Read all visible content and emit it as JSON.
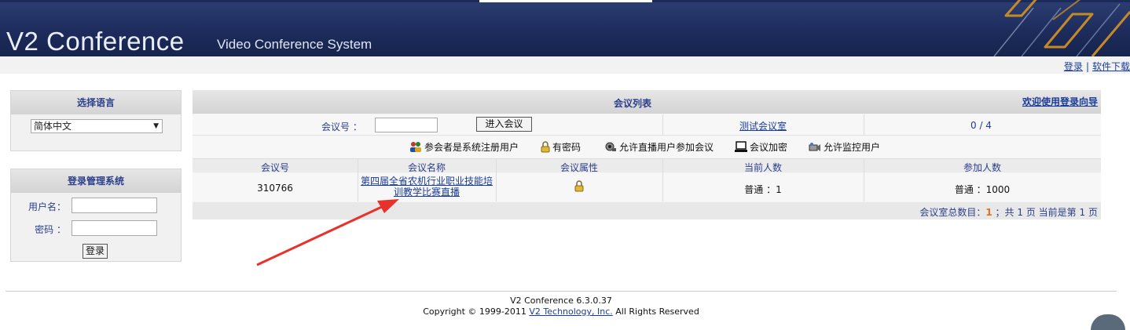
{
  "header": {
    "brand": "V2 Conference",
    "tagline": "Video Conference System"
  },
  "top_links": {
    "login": "登录",
    "separator": "|",
    "software_download": "软件下载"
  },
  "language_panel": {
    "title": "选择语言",
    "selected": "简体中文"
  },
  "login_panel": {
    "title": "登录管理系统",
    "username_label": "用户名：",
    "password_label": "密码 ：",
    "login_button": "登录"
  },
  "meeting_list": {
    "title": "会议列表",
    "wizard_link": "欢迎使用登录向导",
    "join": {
      "label": "会议号 ：",
      "value": "",
      "button": "进入会议"
    },
    "test_room_link": "测试会议室",
    "room_count": "0 / 4",
    "legend": [
      {
        "icon": "registered-users-icon",
        "label": "参会者是系统注册用户"
      },
      {
        "icon": "lock-icon",
        "label": "有密码"
      },
      {
        "icon": "broadcast-icon",
        "label": "允许直播用户参加会议"
      },
      {
        "icon": "encrypt-icon",
        "label": "会议加密"
      },
      {
        "icon": "monitor-camera-icon",
        "label": "允许监控用户"
      }
    ],
    "columns": [
      "会议号",
      "会议名称",
      "会议属性",
      "当前人数",
      "参加人数"
    ],
    "rows": [
      {
        "id": "310766",
        "name_line1": "第四届全省农机行业职业技能培",
        "name_line2": "训教学比赛直播",
        "attribute_icon": "lock-icon",
        "current": "普通 ：1",
        "capacity": "普通 ：1000"
      }
    ],
    "pager": {
      "prefix": "会议室总数目：",
      "total": "1",
      "middle": "；共",
      "pages": "1",
      "page_unit": "页",
      "current_prefix": "当前是第",
      "current": "1",
      "current_unit": "页"
    }
  },
  "footer": {
    "version": "V2 Conference 6.3.0.37",
    "copyright_prefix": "Copyright © 1999-2011",
    "company_link": "V2 Technology, Inc.",
    "rights": "All Rights Reserved"
  },
  "colors": {
    "header_bg": "#1d2c5c",
    "label_blue": "#2b3f8a",
    "link_blue": "#1a3c9a",
    "annotation_arrow": "#e8312a",
    "count_orange": "#e07020"
  }
}
